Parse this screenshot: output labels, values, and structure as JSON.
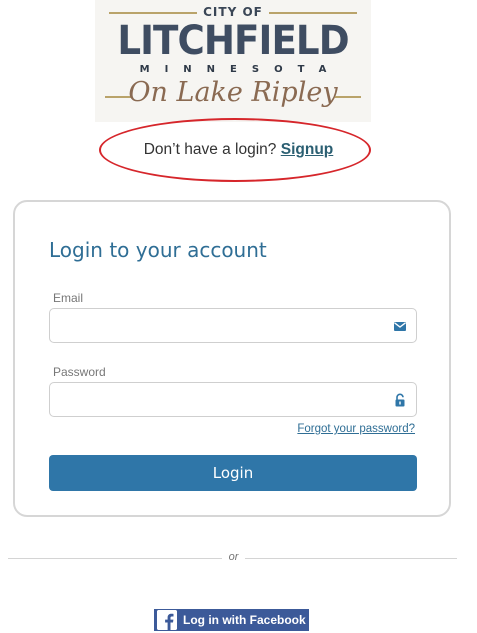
{
  "logo": {
    "city_of": "CITY OF",
    "name": "LITCHFIELD",
    "state": "MINNESOTA",
    "tagline": "On Lake Ripley"
  },
  "signup": {
    "prompt": "Don’t have a login?",
    "link_label": "Signup"
  },
  "login_card": {
    "title": "Login to your account",
    "email_label": "Email",
    "email_value": "",
    "email_icon": "envelope-icon",
    "password_label": "Password",
    "password_value": "",
    "password_icon": "unlock-icon",
    "forgot_label": "Forgot your password?",
    "login_button": "Login"
  },
  "divider": {
    "or_label": "or"
  },
  "facebook": {
    "label": "Log in with Facebook",
    "icon": "facebook-icon"
  },
  "colors": {
    "accent": "#2f76a8",
    "title": "#2f6e95",
    "signup_link": "#2b5f72",
    "annotation_oval": "#d6262b",
    "facebook": "#3c5a99"
  }
}
